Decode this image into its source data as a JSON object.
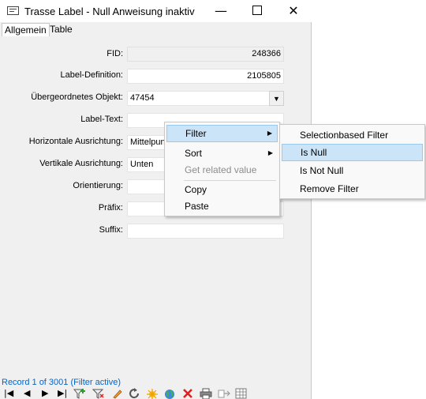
{
  "window": {
    "title": "Trasse Label - Null Anweisung inaktiv",
    "minimize_glyph": "—",
    "close_glyph": "✕"
  },
  "tabs": [
    {
      "label": "Allgemein",
      "active": true
    },
    {
      "label": "Table",
      "active": false
    }
  ],
  "form": {
    "fields": [
      {
        "label": "FID:",
        "value": "248366"
      },
      {
        "label": "Label-Definition:",
        "value": "2105805"
      },
      {
        "label": "Übergeordnetes Objekt:",
        "value": "47454"
      },
      {
        "label": "Label-Text:",
        "value": ""
      },
      {
        "label": "Horizontale Ausrichtung:",
        "value": "Mittelpunkt"
      },
      {
        "label": "Vertikale Ausrichtung:",
        "value": "Unten"
      },
      {
        "label": "Orientierung:",
        "value": ""
      },
      {
        "label": "Präfix:",
        "value": ""
      },
      {
        "label": "Suffix:",
        "value": ""
      }
    ],
    "combo_arrow": "▼"
  },
  "context_menu": {
    "items": [
      {
        "label": "Filter",
        "submenu": true,
        "highlighted": true
      },
      {
        "label": "Sort",
        "submenu": true
      },
      {
        "label": "Get related value",
        "disabled": true
      },
      {
        "label": "Copy"
      },
      {
        "label": "Paste"
      }
    ],
    "arrow": "▶"
  },
  "submenu": {
    "items": [
      {
        "label": "Selectionbased Filter"
      },
      {
        "label": "Is Null",
        "highlighted": true
      },
      {
        "label": "Is Not Null"
      },
      {
        "label": "Remove Filter"
      }
    ]
  },
  "status": {
    "record_text": "Record 1 of 3001 (Filter active)"
  },
  "navbar": {
    "first": "|◀",
    "prev": "◀",
    "next": "▶",
    "last": "▶|",
    "icons": [
      "filter-add-icon",
      "filter-remove-icon",
      "edit-icon",
      "refresh-icon",
      "new-record-icon",
      "globe-icon",
      "delete-icon",
      "print-icon",
      "export-icon",
      "table-icon"
    ]
  },
  "colors": {
    "highlight_bg": "#cce4f7",
    "highlight_border": "#99c9ef",
    "status_text": "#0066cc",
    "delete_red": "#e02020",
    "add_green": "#2aa02a"
  }
}
